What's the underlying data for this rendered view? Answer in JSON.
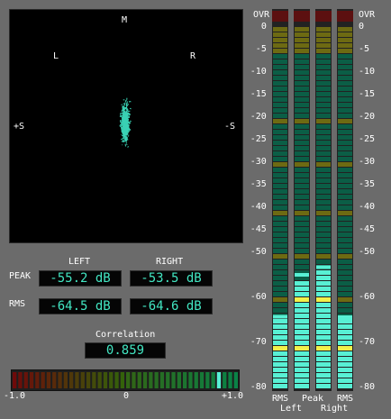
{
  "goniometer": {
    "top": "M",
    "left": "L",
    "right": "R",
    "side_left": "+S",
    "side_right": "-S"
  },
  "readouts": {
    "left_header": "LEFT",
    "right_header": "RIGHT",
    "peak_label": "PEAK",
    "rms_label": "RMS",
    "peak_left": "-55.2 dB",
    "peak_right": "-53.5 dB",
    "rms_left": "-64.5 dB",
    "rms_right": "-64.6 dB"
  },
  "correlation": {
    "label": "Correlation",
    "value": "0.859",
    "level": 0.859,
    "min_label": "-1.0",
    "mid_label": "0",
    "max_label": "+1.0"
  },
  "meters": {
    "ovr_label": "OVR",
    "scale": [
      "0",
      "-5",
      "-10",
      "-15",
      "-20",
      "-25",
      "-30",
      "-35",
      "-40",
      "-45",
      "-50",
      "-60",
      "-70",
      "-80"
    ],
    "bottom_labels": {
      "rms_left": "RMS",
      "peak": "Peak",
      "rms_right": "RMS",
      "left": "Left",
      "right": "Right"
    },
    "channels": [
      {
        "name": "rms-left",
        "level_db": -64.5,
        "hold_db": -64.5
      },
      {
        "name": "peak-left",
        "level_db": -55.2,
        "hold_db": -55.2
      },
      {
        "name": "peak-right",
        "level_db": -53.5,
        "hold_db": -53.5
      },
      {
        "name": "rms-right",
        "level_db": -64.6,
        "hold_db": -64.6
      }
    ],
    "colors": {
      "bg_green": "#0b5e46",
      "lit": "#58f0d4",
      "yellow_bg": "#6d6a12",
      "yellow_lit": "#f2f04a",
      "ovr": "#5c1010",
      "ovr_lit": "#ff3b3b",
      "segment_gap": "#222"
    }
  }
}
